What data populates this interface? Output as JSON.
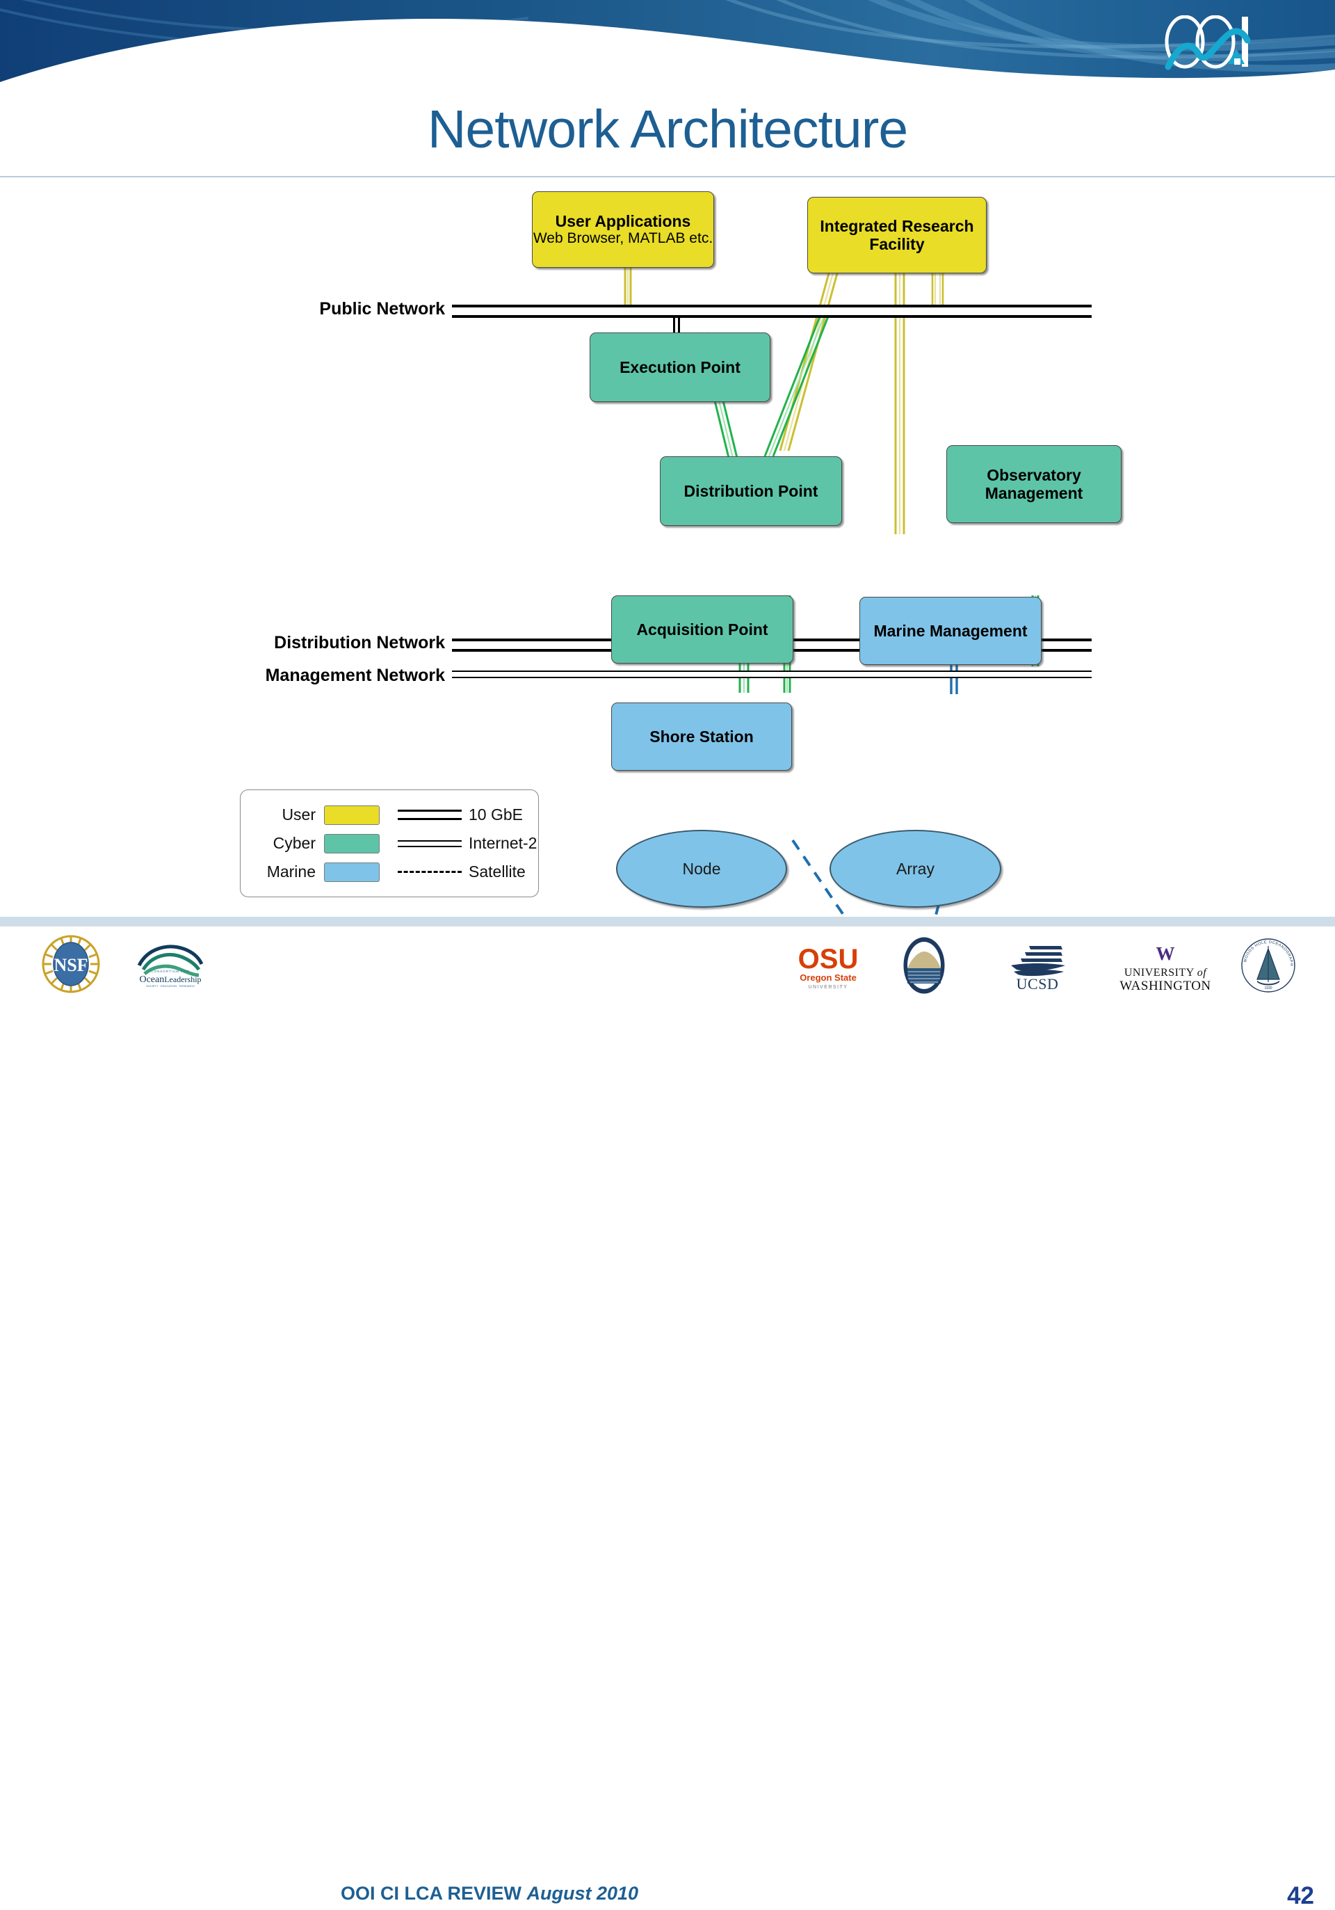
{
  "header": {
    "logo_name": "ooi-logo",
    "brand_colors": {
      "header_dark": "#15457e",
      "header_mid": "#2e6fa3",
      "accent": "#0f9bc4"
    }
  },
  "title": "Network Architecture",
  "footer": {
    "review_text": "OOI CI LCA REVIEW ",
    "review_date": "August 2010",
    "page_number": "42",
    "logos": [
      {
        "name": "nsf-logo",
        "label": "NSF"
      },
      {
        "name": "ocean-leadership-logo",
        "label": "Ocean Leadership",
        "sub": "CONSORTIUM FOR"
      },
      {
        "name": "osu-logo",
        "label": "OSU",
        "sub": "Oregon State",
        "sub2": "UNIVERSITY"
      },
      {
        "name": "scripps-logo",
        "label": "Scripps Institution of Oceanography"
      },
      {
        "name": "ucsd-logo",
        "label": "UCSD"
      },
      {
        "name": "uw-logo",
        "label": "UNIVERSITY of",
        "sub": "WASHINGTON",
        "mark": "W"
      },
      {
        "name": "whoi-logo",
        "label": "WOODS HOLE OCEANOGRAPHIC INSTITUTION",
        "sub": "1930"
      }
    ]
  },
  "diagram": {
    "title": "Network Architecture",
    "colors": {
      "user": "#e9dd27",
      "cyber": "#5ec4a8",
      "marine": "#7fc3e8",
      "link_10gbe": "#000000",
      "link_internet2": "#000000",
      "link_satellite": "#1f6fad",
      "wire_user": "#cbbf33",
      "wire_cyber": "#22b24c",
      "wire_marine": "#1f6fad"
    },
    "nodes": [
      {
        "id": "user-applications",
        "type": "user",
        "title": "User Applications",
        "subtitle": "Web Browser, MATLAB etc."
      },
      {
        "id": "integrated-research-facility",
        "type": "user",
        "title": "Integrated Research Facility",
        "subtitle": ""
      },
      {
        "id": "execution-point",
        "type": "cyber",
        "title": "Execution Point",
        "subtitle": ""
      },
      {
        "id": "distribution-point",
        "type": "cyber",
        "title": "Distribution Point",
        "subtitle": ""
      },
      {
        "id": "observatory-management",
        "type": "cyber",
        "title": "Observatory Management",
        "subtitle": ""
      },
      {
        "id": "acquisition-point",
        "type": "cyber",
        "title": "Acquisition Point",
        "subtitle": ""
      },
      {
        "id": "marine-management",
        "type": "marine",
        "title": "Marine Management",
        "subtitle": ""
      },
      {
        "id": "shore-station",
        "type": "marine",
        "title": "Shore Station",
        "subtitle": ""
      },
      {
        "id": "node",
        "type": "marine-ellipse",
        "title": "Node",
        "subtitle": ""
      },
      {
        "id": "array",
        "type": "marine-ellipse",
        "title": "Array",
        "subtitle": ""
      }
    ],
    "networks": [
      {
        "id": "public-network",
        "label": "Public Network",
        "style": "10 GbE"
      },
      {
        "id": "distribution-network",
        "label": "Distribution Network",
        "style": "10 GbE"
      },
      {
        "id": "management-network",
        "label": "Management Network",
        "style": "Internet-2"
      }
    ],
    "legend": {
      "swatches": [
        {
          "name": "User",
          "color": "#e9dd27"
        },
        {
          "name": "Cyber",
          "color": "#5ec4a8"
        },
        {
          "name": "Marine",
          "color": "#7fc3e8"
        }
      ],
      "lines": [
        {
          "name": "10 GbE",
          "style": "double-thick"
        },
        {
          "name": "Internet-2",
          "style": "double-thin"
        },
        {
          "name": "Satellite",
          "style": "dashed"
        }
      ]
    }
  }
}
